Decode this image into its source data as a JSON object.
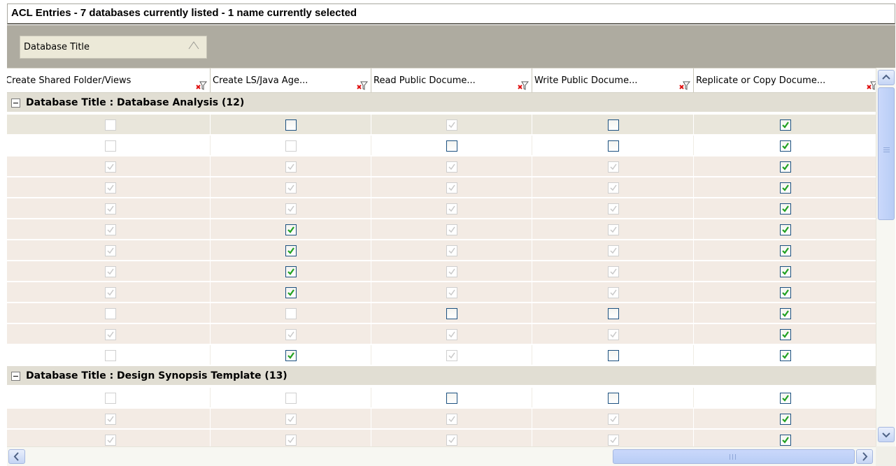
{
  "title_bar": {
    "text": "ACL Entries - 7 databases currently listed - 1 name currently selected"
  },
  "group_panel": {
    "chip_label": "Database Title",
    "sort_indicator": "/\\"
  },
  "columns": [
    {
      "label": "Create Shared Folder/Views"
    },
    {
      "label": "Create LS/Java Age..."
    },
    {
      "label": "Read Public Docume..."
    },
    {
      "label": "Write Public Docume..."
    },
    {
      "label": "Replicate or Copy Docume..."
    }
  ],
  "icons": {
    "filter": "filter-clear-icon",
    "expander": "minus-box-icon",
    "scroll_up": "arrow-up-icon",
    "scroll_down": "arrow-down-icon",
    "scroll_left": "arrow-left-icon",
    "scroll_right": "arrow-right-icon"
  },
  "colors": {
    "check_green": "#21a121",
    "checkbox_blue": "#1c5180",
    "disabled_check": "#c8c8c8",
    "group_band": "#e1ded3",
    "alt_row": "#f3ebe4"
  },
  "state_legend": {
    "c": "checked",
    "u": "unchecked",
    "d": "disabled-checked",
    "e": "disabled-empty"
  },
  "groups": [
    {
      "label": "Database Title : Database Analysis (12)",
      "rows": [
        {
          "style": "sel",
          "cells": [
            "e",
            "u",
            "d",
            "u",
            "c"
          ]
        },
        {
          "style": "white",
          "cells": [
            "e",
            "e",
            "u",
            "u",
            "c"
          ]
        },
        {
          "style": "alt",
          "cells": [
            "d",
            "d",
            "d",
            "d",
            "c"
          ]
        },
        {
          "style": "alt",
          "cells": [
            "d",
            "d",
            "d",
            "d",
            "c"
          ]
        },
        {
          "style": "alt",
          "cells": [
            "d",
            "d",
            "d",
            "d",
            "c"
          ]
        },
        {
          "style": "alt",
          "cells": [
            "d",
            "c",
            "d",
            "d",
            "c"
          ]
        },
        {
          "style": "alt",
          "cells": [
            "d",
            "c",
            "d",
            "d",
            "c"
          ]
        },
        {
          "style": "alt",
          "cells": [
            "d",
            "c",
            "d",
            "d",
            "c"
          ]
        },
        {
          "style": "alt",
          "cells": [
            "d",
            "c",
            "d",
            "d",
            "c"
          ]
        },
        {
          "style": "alt",
          "cells": [
            "e",
            "e",
            "u",
            "u",
            "c"
          ]
        },
        {
          "style": "alt",
          "cells": [
            "d",
            "d",
            "d",
            "d",
            "c"
          ]
        },
        {
          "style": "white",
          "cells": [
            "e",
            "c",
            "d",
            "u",
            "c"
          ]
        }
      ]
    },
    {
      "label": "Database Title : Design Synopsis Template (13)",
      "rows": [
        {
          "style": "white",
          "cells": [
            "e",
            "e",
            "u",
            "u",
            "c"
          ]
        },
        {
          "style": "alt",
          "cells": [
            "d",
            "d",
            "d",
            "d",
            "c"
          ]
        },
        {
          "style": "alt",
          "cells": [
            "d",
            "d",
            "d",
            "d",
            "c"
          ]
        }
      ]
    }
  ]
}
